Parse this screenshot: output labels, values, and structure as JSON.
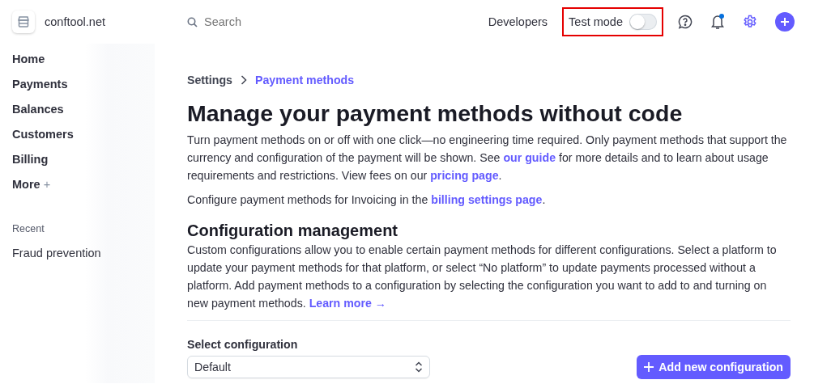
{
  "account": {
    "name": "conftool.net"
  },
  "search": {
    "placeholder": "Search"
  },
  "topbar": {
    "developers": "Developers",
    "test_mode": {
      "label": "Test mode",
      "on": false,
      "highlighted": true
    },
    "notification_dot": true
  },
  "sidebar": {
    "items": [
      {
        "label": "Home"
      },
      {
        "label": "Payments"
      },
      {
        "label": "Balances"
      },
      {
        "label": "Customers"
      },
      {
        "label": "Billing"
      },
      {
        "label": "More",
        "expand": "+"
      }
    ],
    "recent_heading": "Recent",
    "recent": [
      {
        "label": "Fraud prevention"
      }
    ]
  },
  "breadcrumb": [
    {
      "label": "Settings",
      "selected": false
    },
    {
      "label": "Payment methods",
      "selected": true
    }
  ],
  "title": "Manage your payment methods without code",
  "intro": [
    [
      {
        "text": "Turn payment methods on or off with one click—no engineering time required. Only payment methods that support the currency and configuration of the payment will be shown. See "
      },
      {
        "text": "our guide",
        "kind": "link"
      },
      {
        "text": " for more details and to learn about usage requirements and restrictions. View fees on our "
      },
      {
        "text": "pricing page",
        "kind": "link"
      },
      {
        "text": "."
      }
    ],
    [
      {
        "text": "Configure payment methods for Invoicing in the "
      },
      {
        "text": "billing settings page",
        "kind": "link"
      },
      {
        "text": "."
      }
    ]
  ],
  "config": {
    "heading": "Configuration management",
    "description": [
      {
        "text": "Custom configurations allow you to enable certain payment methods for different configurations. Select a platform to update your payment methods for that platform, or select “No platform” to update payments processed without a platform. Add payment methods to a configuration by selecting the configuration you want to add to and turning on new payment methods. "
      },
      {
        "text": "Learn more →",
        "kind": "link"
      }
    ],
    "select_label": "Select configuration",
    "select_value": "Default",
    "add_button": "Add new configuration"
  }
}
